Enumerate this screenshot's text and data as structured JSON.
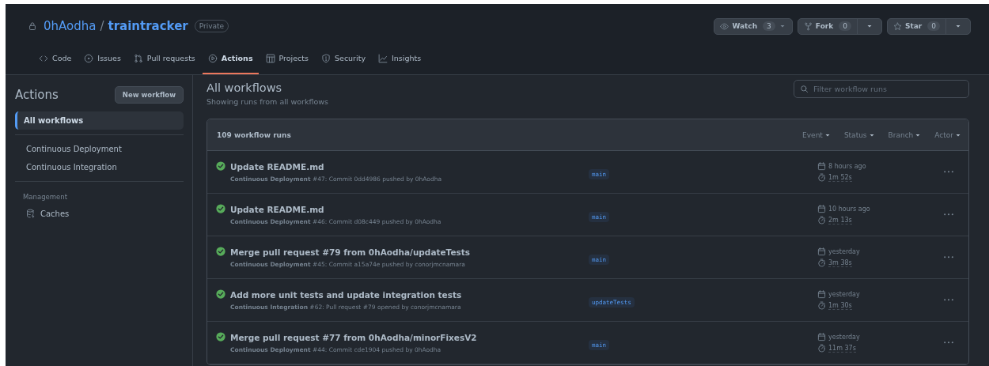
{
  "repo": {
    "owner": "0hAodha",
    "separator": "/",
    "name": "traintracker",
    "visibility": "Private"
  },
  "repo_buttons": [
    {
      "kind": "watch",
      "label": "Watch",
      "count": "3"
    },
    {
      "kind": "fork",
      "label": "Fork",
      "count": "0"
    },
    {
      "kind": "star",
      "label": "Star",
      "count": "0"
    }
  ],
  "tabs": [
    {
      "kind": "code",
      "label": "Code",
      "selected": false
    },
    {
      "kind": "issues",
      "label": "Issues",
      "selected": false
    },
    {
      "kind": "pulls",
      "label": "Pull requests",
      "selected": false
    },
    {
      "kind": "actions",
      "label": "Actions",
      "selected": true
    },
    {
      "kind": "projects",
      "label": "Projects",
      "selected": false
    },
    {
      "kind": "security",
      "label": "Security",
      "selected": false
    },
    {
      "kind": "insights",
      "label": "Insights",
      "selected": false
    }
  ],
  "sidebar": {
    "title": "Actions",
    "new_button": "New workflow",
    "items": [
      {
        "label": "All workflows",
        "selected": true
      },
      {
        "label": "Continuous Deployment",
        "selected": false
      },
      {
        "label": "Continuous Integration",
        "selected": false
      }
    ],
    "section": "Management",
    "management_items": [
      {
        "kind": "caches",
        "label": "Caches"
      }
    ]
  },
  "main": {
    "title": "All workflows",
    "subtitle": "Showing runs from all workflows",
    "filter": {
      "placeholder": "Filter workflow runs"
    }
  },
  "table": {
    "count": "109 workflow runs",
    "filters": [
      "Event",
      "Status",
      "Branch",
      "Actor"
    ],
    "rows": [
      {
        "kind": "success",
        "title": "Update README.md",
        "meta": "**Continuous Deployment** #47: Commit 0dd4986 pushed by 0hAodha",
        "branch": "main",
        "when": "8 hours ago",
        "duration": "1m 52s"
      },
      {
        "kind": "success",
        "title": "Update README.md",
        "meta": "**Continuous Deployment** #46: Commit d08c449 pushed by 0hAodha",
        "branch": "main",
        "when": "10 hours ago",
        "duration": "2m 13s"
      },
      {
        "kind": "success",
        "title": "Merge pull request #79 from 0hAodha/updateTests",
        "meta": "**Continuous Deployment** #45: Commit a15a74e pushed by conorjmcnamara",
        "branch": "main",
        "when": "yesterday",
        "duration": "3m 38s"
      },
      {
        "kind": "success",
        "title": "Add more unit tests and update integration tests",
        "meta": "**Continuous Integration** #62: Pull request #79 opened by conorjmcnamara",
        "branch": "updateTests",
        "when": "yesterday",
        "duration": "1m 30s"
      },
      {
        "kind": "success",
        "title": "Merge pull request #77 from 0hAodha/minorFixesV2",
        "meta": "**Continuous Deployment** #44: Commit cde1904 pushed by 0hAodha",
        "branch": "main",
        "when": "yesterday",
        "duration": "11m 37s"
      }
    ]
  }
}
